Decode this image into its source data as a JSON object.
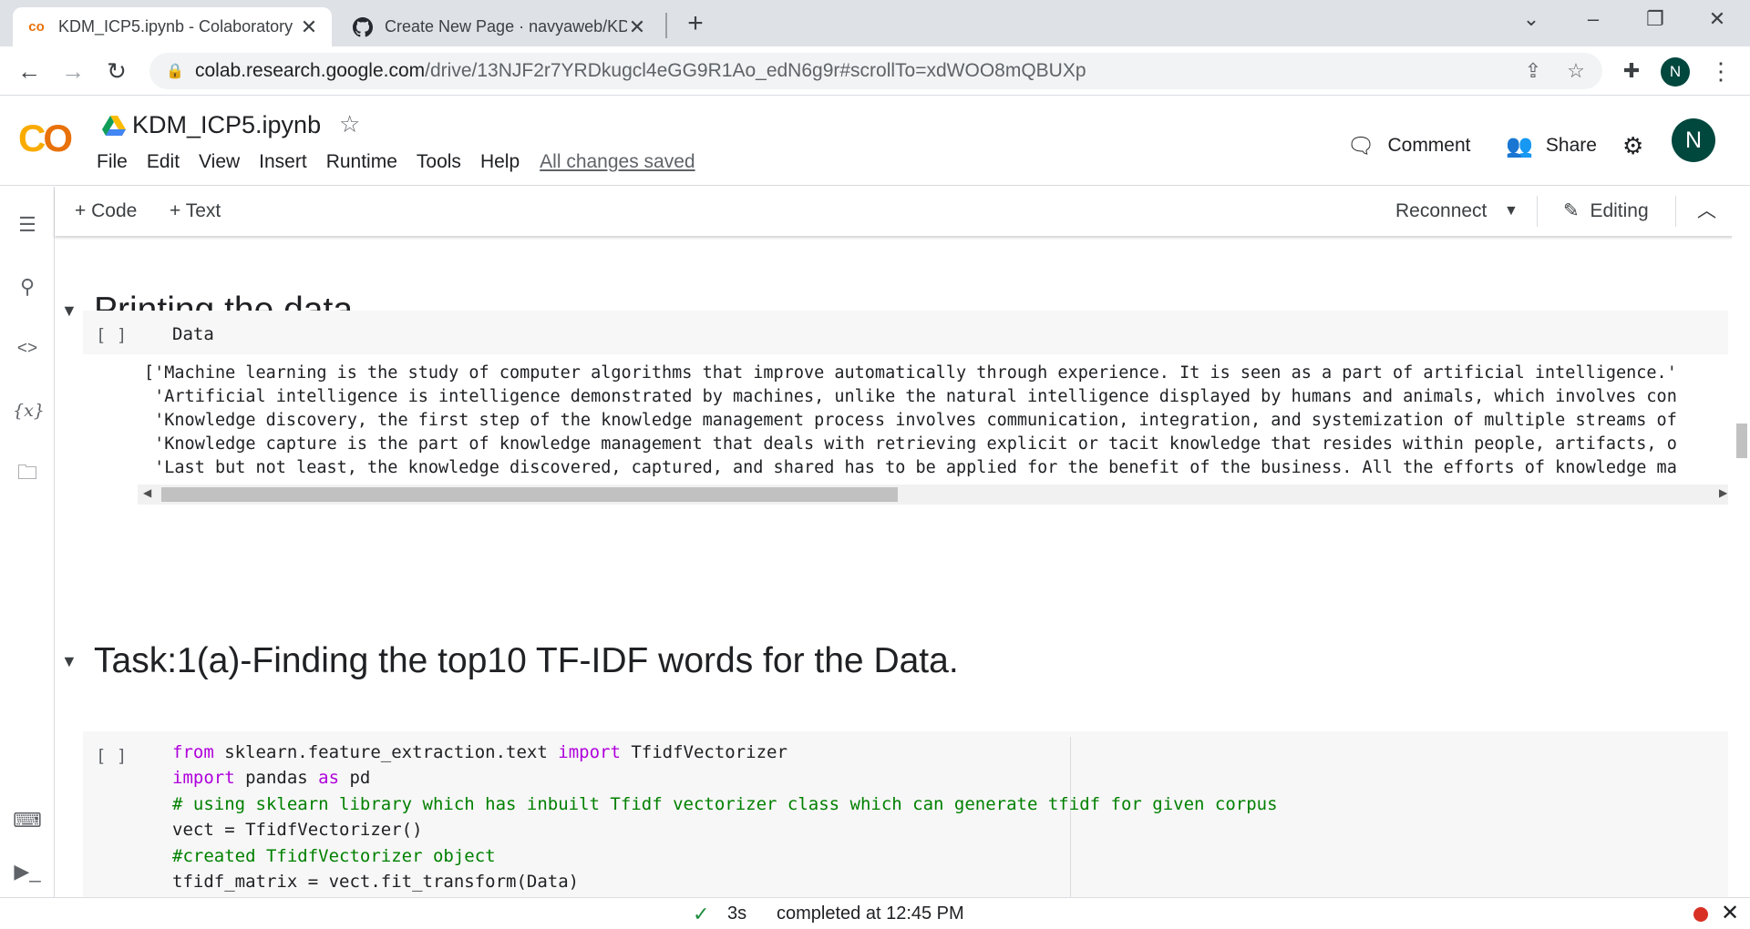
{
  "browser": {
    "tabs": [
      {
        "title": "KDM_ICP5.ipynb - Colaboratory",
        "favicon": "colab-icon"
      },
      {
        "title": "Create New Page · navyaweb/KDM",
        "favicon": "github-icon"
      }
    ],
    "url_host": "colab.research.google.com",
    "url_path": "/drive/13NJF2r7YRDkugcl4eGG9R1Ao_edN6g9r#scrollTo=xdWOO8mQBUXp",
    "profile_initial": "N"
  },
  "colab": {
    "logo": "CO",
    "notebook_title": "KDM_ICP5.ipynb",
    "menu": [
      "File",
      "Edit",
      "View",
      "Insert",
      "Runtime",
      "Tools",
      "Help"
    ],
    "save_status": "All changes saved",
    "comment_label": "Comment",
    "share_label": "Share",
    "avatar_initial": "N"
  },
  "toolbar": {
    "add_code": "+ Code",
    "add_text": "+ Text",
    "reconnect": "Reconnect",
    "editing": "Editing"
  },
  "sections": [
    {
      "title": "Printing the data"
    },
    {
      "title": "Task:1(a)-Finding the top10 TF-IDF words for the Data."
    }
  ],
  "cell1": {
    "run_label": "[ ]",
    "code": "Data",
    "output": [
      "['Machine learning is the study of computer algorithms that improve automatically through experience. It is seen as a part of artificial intelligence.'",
      " 'Artificial intelligence is intelligence demonstrated by machines, unlike the natural intelligence displayed by humans and animals, which involves con",
      " 'Knowledge discovery, the first step of the knowledge management process involves communication, integration, and systemization of multiple streams of",
      " 'Knowledge capture is the part of knowledge management that deals with retrieving explicit or tacit knowledge that resides within people, artifacts, o",
      " 'Last but not least, the knowledge discovered, captured, and shared has to be applied for the benefit of the business. All the efforts of knowledge ma"
    ]
  },
  "cell2": {
    "run_label": "[ ]",
    "lines": {
      "l1_kw1": "from",
      "l1_mod": " sklearn.feature_extraction.text ",
      "l1_kw2": "import",
      "l1_name": " TfidfVectorizer",
      "l2_kw1": "import",
      "l2_mod": " pandas ",
      "l2_kw2": "as",
      "l2_name": " pd",
      "l3": "# using sklearn library which has inbuilt Tfidf vectorizer class which can generate tfidf for given corpus",
      "l4": "vect = TfidfVectorizer()",
      "l5": "#created TfidfVectorizer object",
      "l6": "tfidf_matrix = vect.fit_transform(Data)"
    }
  },
  "status": {
    "check": "✓",
    "duration": "3s",
    "message": "completed at 12:45 PM"
  }
}
